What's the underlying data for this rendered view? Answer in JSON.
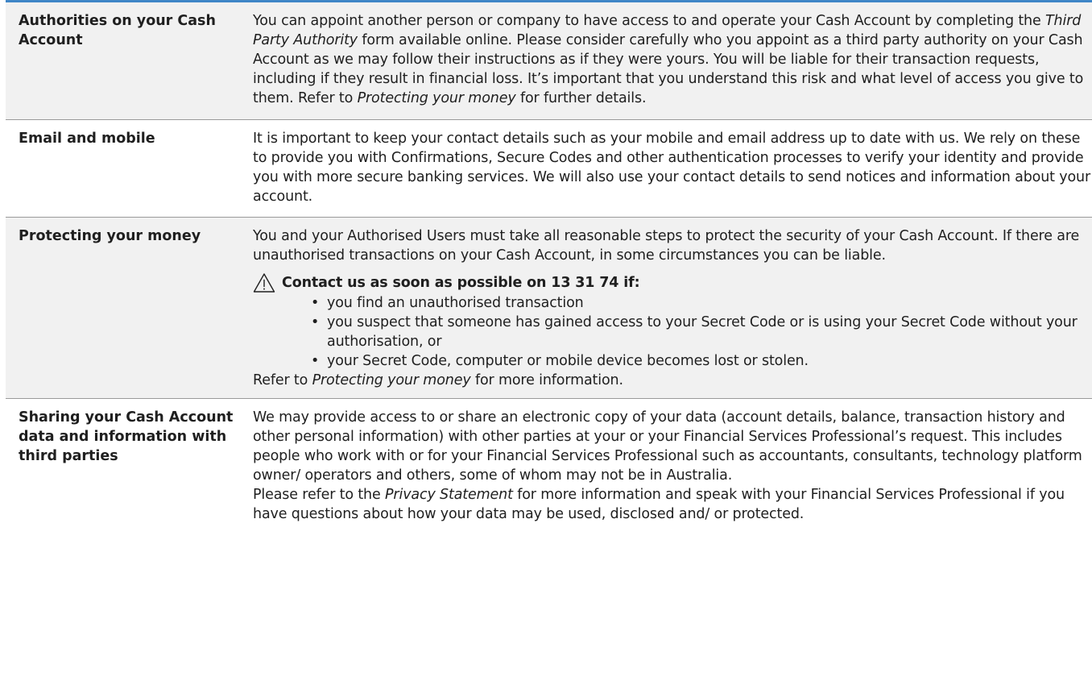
{
  "rows": [
    {
      "heading": "Authorities on your Cash Account",
      "text_1": "You can appoint another person or company to have access to and operate your Cash Account by completing the ",
      "em_1": "Third Party Authority",
      "text_2": " form available online. Please consider carefully who you appoint as a third party authority on your Cash Account as we may follow their instructions as if they were yours. You will be liable for their transaction requests, including if they result in financial loss. It’s important that you understand this risk and what level of access you give to them. Refer to ",
      "em_2": "Protecting your money",
      "text_3": " for further details."
    },
    {
      "heading": "Email and mobile",
      "text": "It is important to keep your contact details such as your mobile and email address up to date with us. We rely on these to provide you with Confirmations, Secure Codes and other authentication processes to verify your identity and provide you with more secure banking services. We will also use your contact details to send notices and information about your account."
    },
    {
      "heading": "Protecting your money",
      "text": "You and your Authorised Users must take all reasonable steps to protect the security of your Cash Account. If there are unauthorised transactions on your Cash Account, in some circumstances you can be liable.",
      "warning_title": "Contact us as soon as possible on 13 31 74 if:",
      "bullets": [
        "you find an unauthorised transaction",
        "you suspect that someone has gained access to your Secret Code or is using your Secret Code without your authorisation, or",
        "your Secret Code, computer or mobile device becomes lost or stolen."
      ],
      "refer_prefix": "Refer to ",
      "refer_em": "Protecting your money",
      "refer_suffix": " for more information."
    },
    {
      "heading": "Sharing your Cash Account data and information with third parties",
      "text": "We may provide access to or share an electronic copy of your data (account details, balance, transaction history and other personal information) with other parties at your or your Financial Services Professional’s request. This includes people who work with or for your Financial Services Professional such as accountants, consultants, technology platform owner/ operators and others, some of whom may not be in Australia.",
      "text_2_prefix": "Please refer to the ",
      "text_2_em": "Privacy Statement",
      "text_2_suffix": " for more information and speak with your Financial Services Professional if you have questions about how your data may be used, disclosed and/ or protected."
    }
  ],
  "colors": {
    "accent_rule": "#3f86c7",
    "row_shade": "#f1f1f1",
    "divider": "#9a9a9a",
    "text": "#1f1f1f"
  },
  "icons": {
    "warning": "warning-triangle-icon"
  }
}
